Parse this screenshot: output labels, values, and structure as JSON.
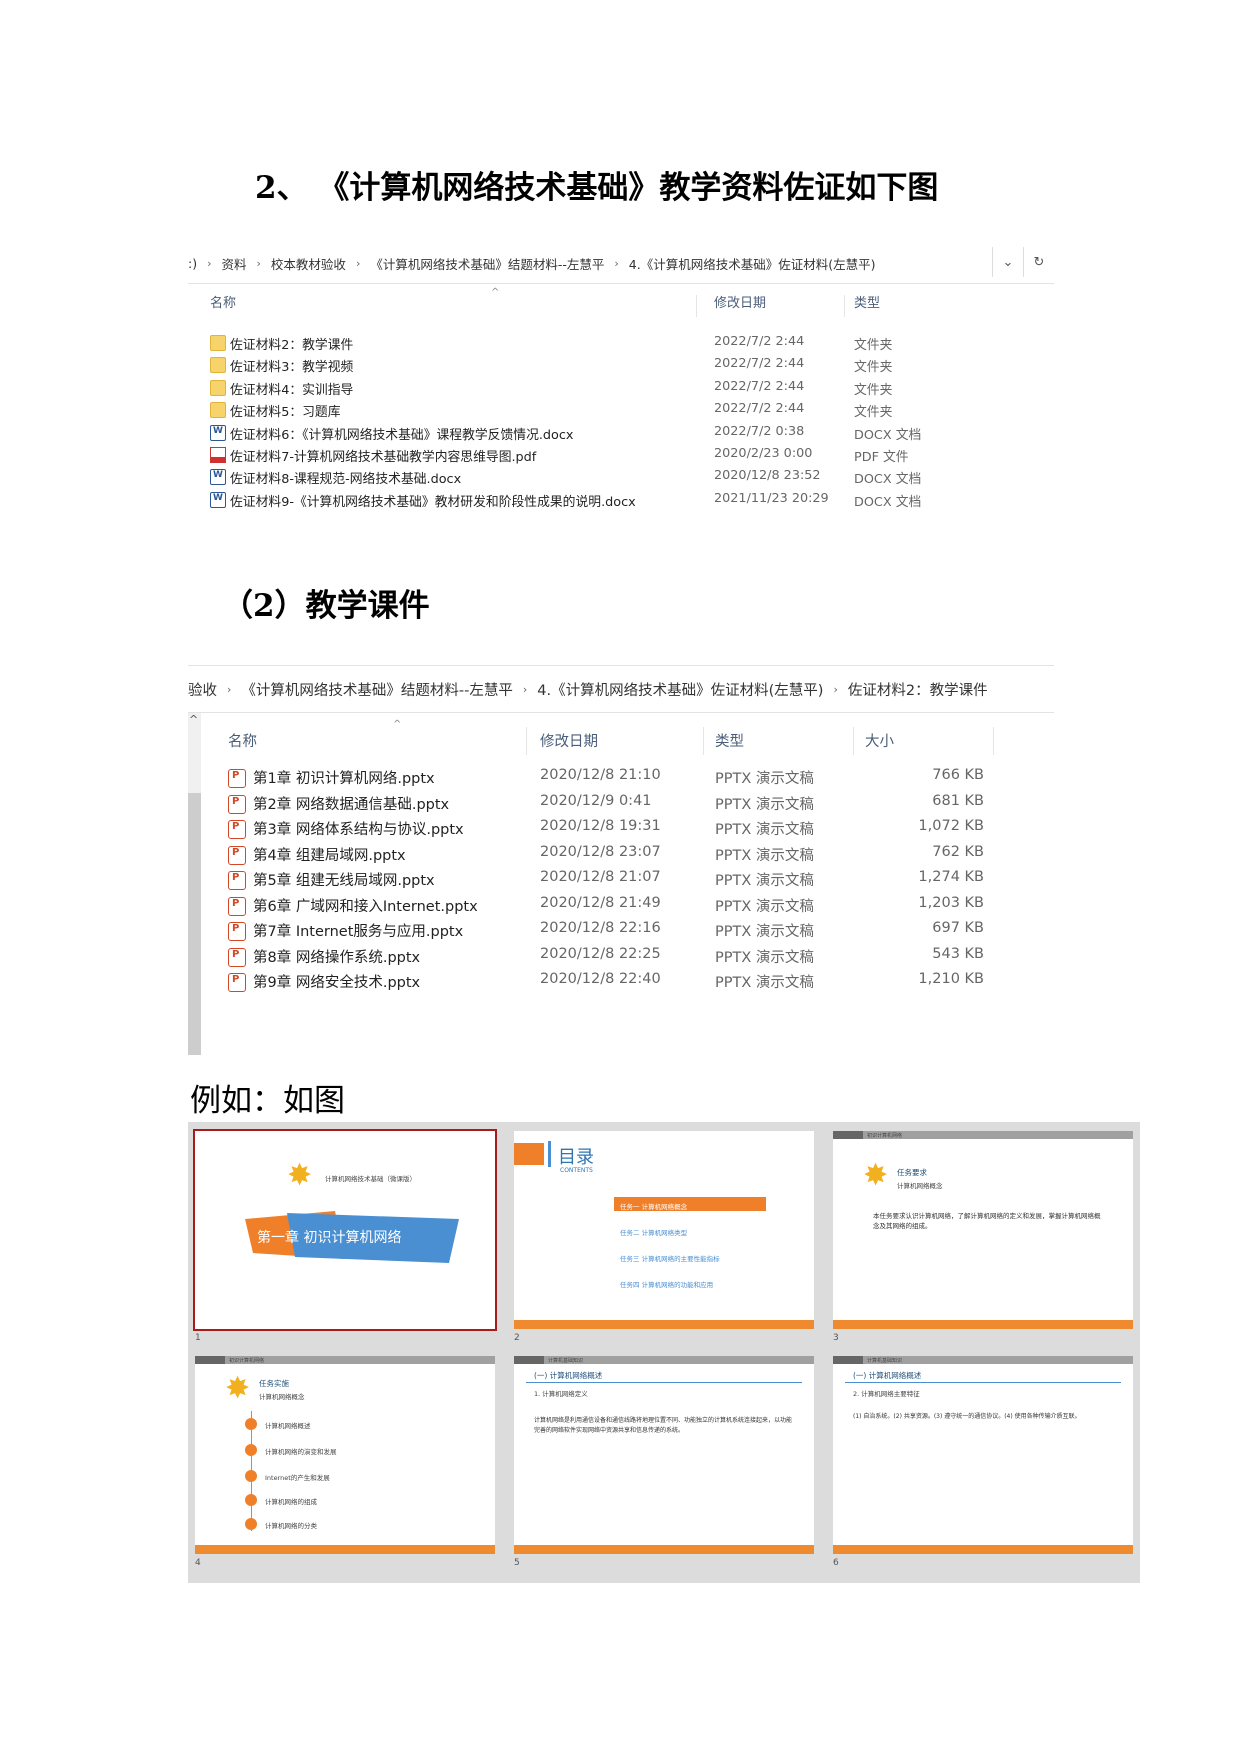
{
  "headings": {
    "section2": "2、  《计算机网络技术基础》教学资料佐证如下图",
    "courseware": "（2）教学课件",
    "example": "例如：如图"
  },
  "explorer1": {
    "breadcrumb": [
      ":)",
      "资料",
      "校本教材验收",
      "《计算机网络技术基础》结题材料--左慧平",
      "4.《计算机网络技术基础》佐证材料(左慧平)"
    ],
    "columns": {
      "name": "名称",
      "modified": "修改日期",
      "type": "类型"
    },
    "rows": [
      {
        "name": "佐证材料2：教学课件",
        "modified": "2022/7/2 2:44",
        "type": "文件夹",
        "icon": "folder-icon"
      },
      {
        "name": "佐证材料3：教学视频",
        "modified": "2022/7/2 2:44",
        "type": "文件夹",
        "icon": "folder-icon"
      },
      {
        "name": "佐证材料4：实训指导",
        "modified": "2022/7/2 2:44",
        "type": "文件夹",
        "icon": "folder-icon"
      },
      {
        "name": "佐证材料5：习题库",
        "modified": "2022/7/2 2:44",
        "type": "文件夹",
        "icon": "folder-icon"
      },
      {
        "name": "佐证材料6：《计算机网络技术基础》课程教学反馈情况.docx",
        "modified": "2022/7/2 0:38",
        "type": "DOCX 文档",
        "icon": "docx-icon"
      },
      {
        "name": "佐证材料7-计算机网络技术基础教学内容思维导图.pdf",
        "modified": "2020/2/23 0:00",
        "type": "PDF 文件",
        "icon": "pdf-icon"
      },
      {
        "name": "佐证材料8-课程规范-网络技术基础.docx",
        "modified": "2020/12/8 23:52",
        "type": "DOCX 文档",
        "icon": "docx-icon"
      },
      {
        "name": "佐证材料9-《计算机网络技术基础》教材研发和阶段性成果的说明.docx",
        "modified": "2021/11/23 20:29",
        "type": "DOCX 文档",
        "icon": "docx-icon"
      }
    ]
  },
  "explorer2": {
    "breadcrumb": [
      "验收",
      "《计算机网络技术基础》结题材料--左慧平",
      "4.《计算机网络技术基础》佐证材料(左慧平)",
      "佐证材料2：教学课件"
    ],
    "columns": {
      "name": "名称",
      "modified": "修改日期",
      "type": "类型",
      "size": "大小"
    },
    "rows": [
      {
        "name": "第1章 初识计算机网络.pptx",
        "modified": "2020/12/8 21:10",
        "type": "PPTX 演示文稿",
        "size": "766 KB"
      },
      {
        "name": "第2章 网络数据通信基础.pptx",
        "modified": "2020/12/9 0:41",
        "type": "PPTX 演示文稿",
        "size": "681 KB"
      },
      {
        "name": "第3章 网络体系结构与协议.pptx",
        "modified": "2020/12/8 19:31",
        "type": "PPTX 演示文稿",
        "size": "1,072 KB"
      },
      {
        "name": "第4章 组建局域网.pptx",
        "modified": "2020/12/8 23:07",
        "type": "PPTX 演示文稿",
        "size": "762 KB"
      },
      {
        "name": "第5章 组建无线局域网.pptx",
        "modified": "2020/12/8 21:07",
        "type": "PPTX 演示文稿",
        "size": "1,274 KB"
      },
      {
        "name": "第6章 广域网和接入Internet.pptx",
        "modified": "2020/12/8 21:49",
        "type": "PPTX 演示文稿",
        "size": "1,203 KB"
      },
      {
        "name": "第7章 Internet服务与应用.pptx",
        "modified": "2020/12/8 22:16",
        "type": "PPTX 演示文稿",
        "size": "697 KB"
      },
      {
        "name": "第8章 网络操作系统.pptx",
        "modified": "2020/12/8 22:25",
        "type": "PPTX 演示文稿",
        "size": "543 KB"
      },
      {
        "name": "第9章 网络安全技术.pptx",
        "modified": "2020/12/8 22:40",
        "type": "PPTX 演示文稿",
        "size": "1,210 KB"
      }
    ]
  },
  "slides": {
    "s1": {
      "num": "1",
      "brand": "计算机网络技术基础（微课版）",
      "title": "第一章  初识计算机网络"
    },
    "s2": {
      "num": "2",
      "title": "目录",
      "subtitle": "CONTENTS",
      "items": [
        "任务一 计算机网络概念",
        "任务二 计算机网络类型",
        "任务三 计算机网络的主要性能指标",
        "任务四 计算机网络的功能和应用"
      ]
    },
    "s3": {
      "num": "3",
      "tag": "初识计算机网络",
      "heading": "任务要求",
      "sub": "计算机网络概念",
      "body": "本任务要求认识计算机网络，了解计算机网络的定义和发展，掌握计算机网络概念及其网络的组成。"
    },
    "s4": {
      "num": "4",
      "tag": "初识计算机网络",
      "heading": "任务实施",
      "sub": "计算机网络概念",
      "items": [
        "计算机网络概述",
        "计算机网络的演变和发展",
        "Internet的产生和发展",
        "计算机网络的组成",
        "计算机网络的分类"
      ]
    },
    "s5": {
      "num": "5",
      "tag": "计算机基础知识",
      "heading": "(一) 计算机网络概述",
      "sub": "1. 计算机网络定义",
      "body": "计算机网络是利用通信设备和通信线路将地理位置不同、功能独立的计算机系统连接起来，以功能完善的网络软件实现网络中资源共享和信息传递的系统。"
    },
    "s6": {
      "num": "6",
      "tag": "计算机基础知识",
      "heading": "(一) 计算机网络概述",
      "sub": "2. 计算机网络主要特征",
      "body": "(1) 自治系统。(2) 共享资源。(3) 遵守统一的通信协议。(4) 使用各种传输介质互联。"
    }
  }
}
